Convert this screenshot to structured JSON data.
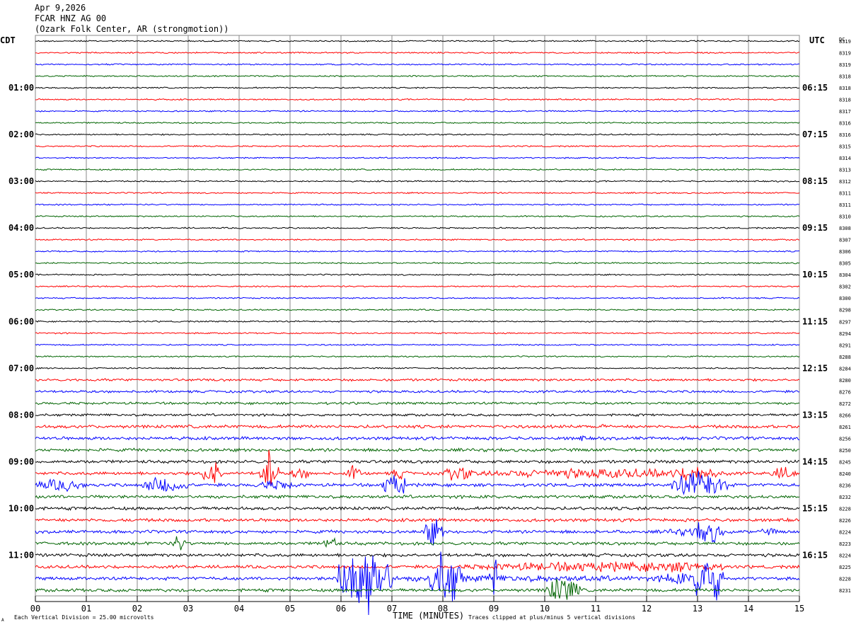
{
  "header": {
    "date": "Apr 9,2026",
    "station": "FCAR HNZ AG 00",
    "location": "(Ozark Folk Center, AR (strongmotion))"
  },
  "chart_data": {
    "type": "line",
    "subtype": "helicorder",
    "left_axis_label": "CDT",
    "right_axis_label": "UTC",
    "dc_label": "DC",
    "xlabel": "TIME (MINUTES)",
    "xlim": [
      0,
      15
    ],
    "x_ticks": [
      "00",
      "01",
      "02",
      "03",
      "04",
      "05",
      "06",
      "07",
      "08",
      "09",
      "10",
      "11",
      "12",
      "13",
      "14",
      "15"
    ],
    "left_time_labels": [
      {
        "row": 4,
        "label": "01:00"
      },
      {
        "row": 8,
        "label": "02:00"
      },
      {
        "row": 12,
        "label": "03:00"
      },
      {
        "row": 16,
        "label": "04:00"
      },
      {
        "row": 20,
        "label": "05:00"
      },
      {
        "row": 24,
        "label": "06:00"
      },
      {
        "row": 28,
        "label": "07:00"
      },
      {
        "row": 32,
        "label": "08:00"
      },
      {
        "row": 36,
        "label": "09:00"
      },
      {
        "row": 40,
        "label": "10:00"
      },
      {
        "row": 44,
        "label": "11:00"
      }
    ],
    "right_time_labels": [
      {
        "row": 4,
        "label": "06:15"
      },
      {
        "row": 8,
        "label": "07:15"
      },
      {
        "row": 12,
        "label": "08:15"
      },
      {
        "row": 16,
        "label": "09:15"
      },
      {
        "row": 20,
        "label": "10:15"
      },
      {
        "row": 24,
        "label": "11:15"
      },
      {
        "row": 28,
        "label": "12:15"
      },
      {
        "row": 32,
        "label": "13:15"
      },
      {
        "row": 36,
        "label": "14:15"
      },
      {
        "row": 40,
        "label": "15:15"
      },
      {
        "row": 44,
        "label": "16:15"
      }
    ],
    "trace_colors": [
      "#000000",
      "#ff0000",
      "#0000ff",
      "#006400"
    ],
    "dc_values": [
      "8319",
      "8319",
      "8319",
      "8318",
      "8318",
      "8318",
      "8317",
      "8316",
      "8316",
      "8315",
      "8314",
      "8313",
      "8312",
      "8311",
      "8311",
      "8310",
      "8308",
      "8307",
      "8306",
      "8305",
      "8304",
      "8302",
      "8300",
      "8298",
      "8297",
      "8294",
      "8291",
      "8288",
      "8284",
      "8280",
      "8276",
      "8272",
      "8266",
      "8261",
      "8256",
      "8250",
      "8245",
      "8240",
      "8236",
      "8232",
      "8228",
      "8226",
      "8224",
      "8223",
      "8224",
      "8225",
      "8228",
      "8231"
    ],
    "grid": true
  },
  "footer": {
    "scale_text": "Each Vertical Division =   25.00 microvolts",
    "clip_text": "Traces clipped at plus/minus 5 vertical divisions",
    "corner_mark": "A"
  }
}
